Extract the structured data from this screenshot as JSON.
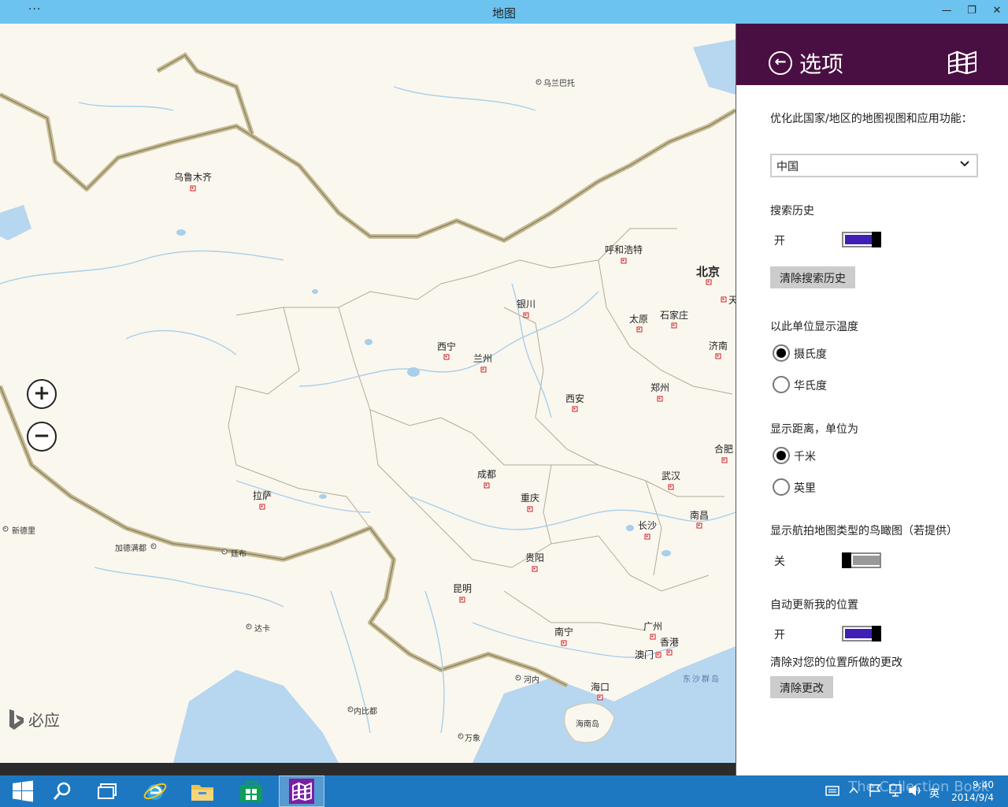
{
  "window": {
    "title": "地图",
    "menu_label": "···",
    "minimize": "—",
    "restore": "❐",
    "close": "✕"
  },
  "map": {
    "zoom_in": "+",
    "zoom_out": "−",
    "bing_label": "必应",
    "cities": [
      {
        "name": "乌鲁木齐"
      },
      {
        "name": "乌兰巴托"
      },
      {
        "name": "呼和浩特"
      },
      {
        "name": "北京"
      },
      {
        "name": "天"
      },
      {
        "name": "银川"
      },
      {
        "name": "太原"
      },
      {
        "name": "石家庄"
      },
      {
        "name": "西宁"
      },
      {
        "name": "兰州"
      },
      {
        "name": "济南"
      },
      {
        "name": "西安"
      },
      {
        "name": "郑州"
      },
      {
        "name": "合肥"
      },
      {
        "name": "成都"
      },
      {
        "name": "武汉"
      },
      {
        "name": "重庆"
      },
      {
        "name": "拉萨"
      },
      {
        "name": "长沙"
      },
      {
        "name": "南昌"
      },
      {
        "name": "新德里"
      },
      {
        "name": "加德满都"
      },
      {
        "name": "廷布"
      },
      {
        "name": "贵阳"
      },
      {
        "name": "昆明"
      },
      {
        "name": "达卡"
      },
      {
        "name": "广州"
      },
      {
        "name": "南宁"
      },
      {
        "name": "香港"
      },
      {
        "name": "澳门"
      },
      {
        "name": "河内"
      },
      {
        "name": "海口"
      },
      {
        "name": "东沙群岛"
      },
      {
        "name": "内比都"
      },
      {
        "name": "海南岛"
      },
      {
        "name": "万象"
      }
    ]
  },
  "panel": {
    "title": "选项",
    "country_label": "优化此国家/地区的地图视图和应用功能：",
    "country_value": "中国",
    "search_history_label": "搜索历史",
    "search_history_state": "开",
    "search_history_on": true,
    "clear_search_button": "清除搜索历史",
    "temperature_label": "以此单位显示温度",
    "temperature_options": [
      "摄氏度",
      "华氏度"
    ],
    "temperature_selected": 0,
    "distance_label": "显示距离，单位为",
    "distance_options": [
      "千米",
      "英里"
    ],
    "distance_selected": 0,
    "birdseye_label": "显示航拍地图类型的鸟瞰图（若提供）",
    "birdseye_state": "关",
    "birdseye_on": false,
    "auto_location_label": "自动更新我的位置",
    "auto_location_state": "开",
    "auto_location_on": true,
    "clear_location_label": "清除对您的位置所做的更改",
    "clear_location_button": "清除更改",
    "accent_color": "#3f1fb5",
    "header_color": "#4a0f42"
  },
  "taskbar": {
    "clock_time": "9:40",
    "clock_date": "2014/9/4",
    "ime": "英",
    "watermark": "The Collection Book"
  }
}
